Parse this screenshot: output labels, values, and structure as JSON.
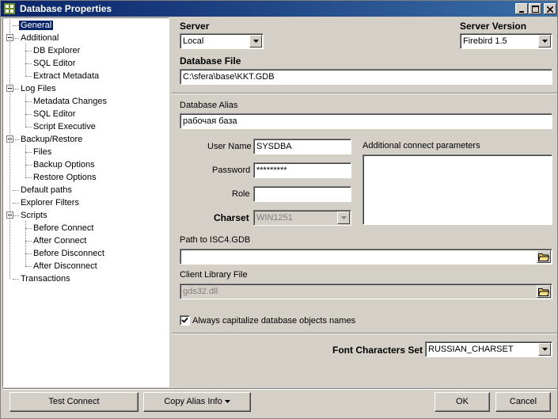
{
  "window": {
    "title": "Database Properties"
  },
  "tree": {
    "items": [
      {
        "label": "General",
        "level": 0,
        "selected": true
      },
      {
        "label": "Additional",
        "level": 0,
        "expandable": true
      },
      {
        "label": "DB Explorer",
        "level": 1
      },
      {
        "label": "SQL Editor",
        "level": 1
      },
      {
        "label": "Extract Metadata",
        "level": 1
      },
      {
        "label": "Log Files",
        "level": 0,
        "expandable": true
      },
      {
        "label": "Metadata Changes",
        "level": 1
      },
      {
        "label": "SQL Editor",
        "level": 1
      },
      {
        "label": "Script Executive",
        "level": 1
      },
      {
        "label": "Backup/Restore",
        "level": 0,
        "expandable": true
      },
      {
        "label": "Files",
        "level": 1
      },
      {
        "label": "Backup Options",
        "level": 1
      },
      {
        "label": "Restore Options",
        "level": 1
      },
      {
        "label": "Default paths",
        "level": 0
      },
      {
        "label": "Explorer Filters",
        "level": 0
      },
      {
        "label": "Scripts",
        "level": 0,
        "expandable": true
      },
      {
        "label": "Before Connect",
        "level": 1
      },
      {
        "label": "After Connect",
        "level": 1
      },
      {
        "label": "Before Disconnect",
        "level": 1
      },
      {
        "label": "After Disconnect",
        "level": 1
      },
      {
        "label": "Transactions",
        "level": 0
      }
    ]
  },
  "general": {
    "server_label": "Server",
    "server_value": "Local",
    "server_version_label": "Server Version",
    "server_version_value": "Firebird 1.5",
    "database_file_label": "Database File",
    "database_file_value": "C:\\sfera\\base\\KKT.GDB",
    "database_alias_label": "Database Alias",
    "database_alias_value": "рабочая база",
    "user_name_label": "User Name",
    "user_name_value": "SYSDBA",
    "password_label": "Password",
    "password_value": "*********",
    "role_label": "Role",
    "role_value": "",
    "charset_label": "Charset",
    "charset_value": "WIN1251",
    "additional_params_label": "Additional connect parameters",
    "path_isc4_label": "Path to ISC4.GDB",
    "path_isc4_value": "",
    "client_library_label": "Client Library File",
    "client_library_value": "gds32.dll",
    "capitalize_label": "Always capitalize database objects names",
    "capitalize_checked": true,
    "font_charset_label": "Font Characters Set",
    "font_charset_value": "RUSSIAN_CHARSET"
  },
  "buttons": {
    "test_connect": "Test Connect",
    "copy_alias": "Copy Alias Info",
    "ok": "OK",
    "cancel": "Cancel"
  }
}
